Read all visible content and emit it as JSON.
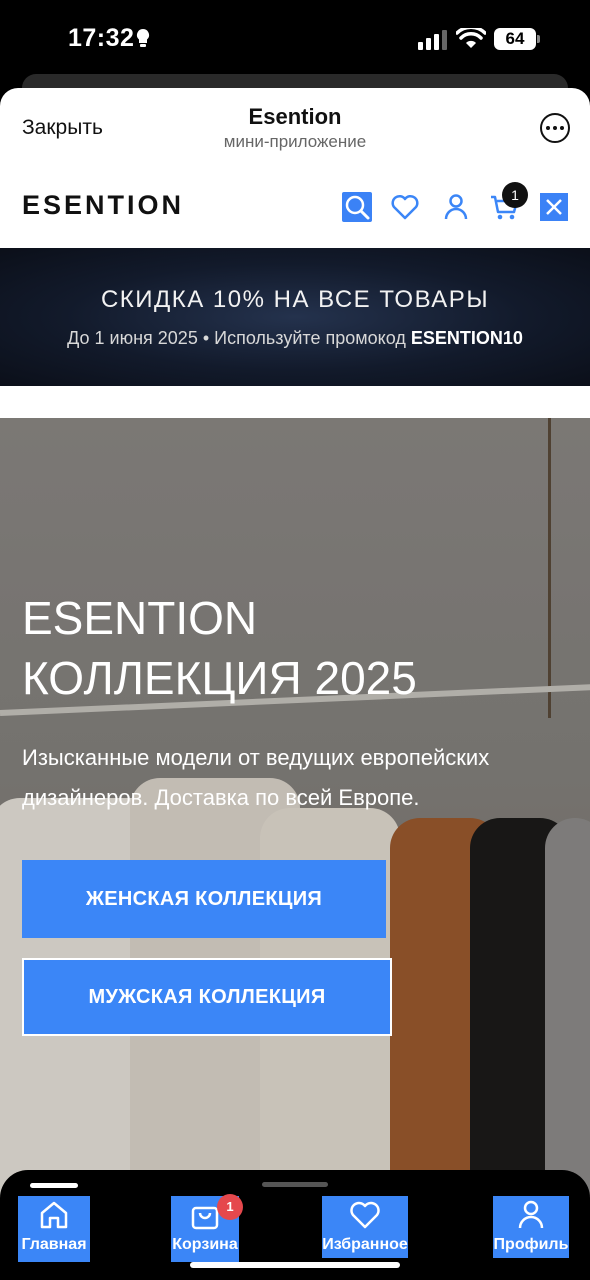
{
  "status_bar": {
    "time": "17:32",
    "battery": "64"
  },
  "mini_app": {
    "close_label": "Закрыть",
    "title": "Esention",
    "subtitle": "мини-приложение"
  },
  "site_header": {
    "logo": "ESENTION",
    "cart_count": "1"
  },
  "promo": {
    "title": "СКИДКА 10% НА ВСЕ ТОВАРЫ",
    "subtitle_prefix": "До 1 июня 2025 • Используйте промокод ",
    "promo_code": "ESENTION10"
  },
  "hero": {
    "title_line1": "ESENTION",
    "title_line2": "КОЛЛЕКЦИЯ 2025",
    "description": "Изысканные модели от ведущих европейских дизайнеров. Доставка по всей Европе.",
    "women_button": "ЖЕНСКАЯ КОЛЛЕКЦИЯ",
    "men_button": "МУЖСКАЯ КОЛЛЕКЦИЯ"
  },
  "bottom_nav": {
    "items": [
      {
        "label": "Главная",
        "icon": "home-icon"
      },
      {
        "label": "Корзина",
        "icon": "bag-icon"
      },
      {
        "label": "Избранное",
        "icon": "heart-icon"
      },
      {
        "label": "Профиль",
        "icon": "user-icon"
      }
    ],
    "cart_badge": "1"
  },
  "colors": {
    "accent": "#3b86f7",
    "promo_bg": "#121a2b",
    "badge_red": "#e5484d"
  }
}
